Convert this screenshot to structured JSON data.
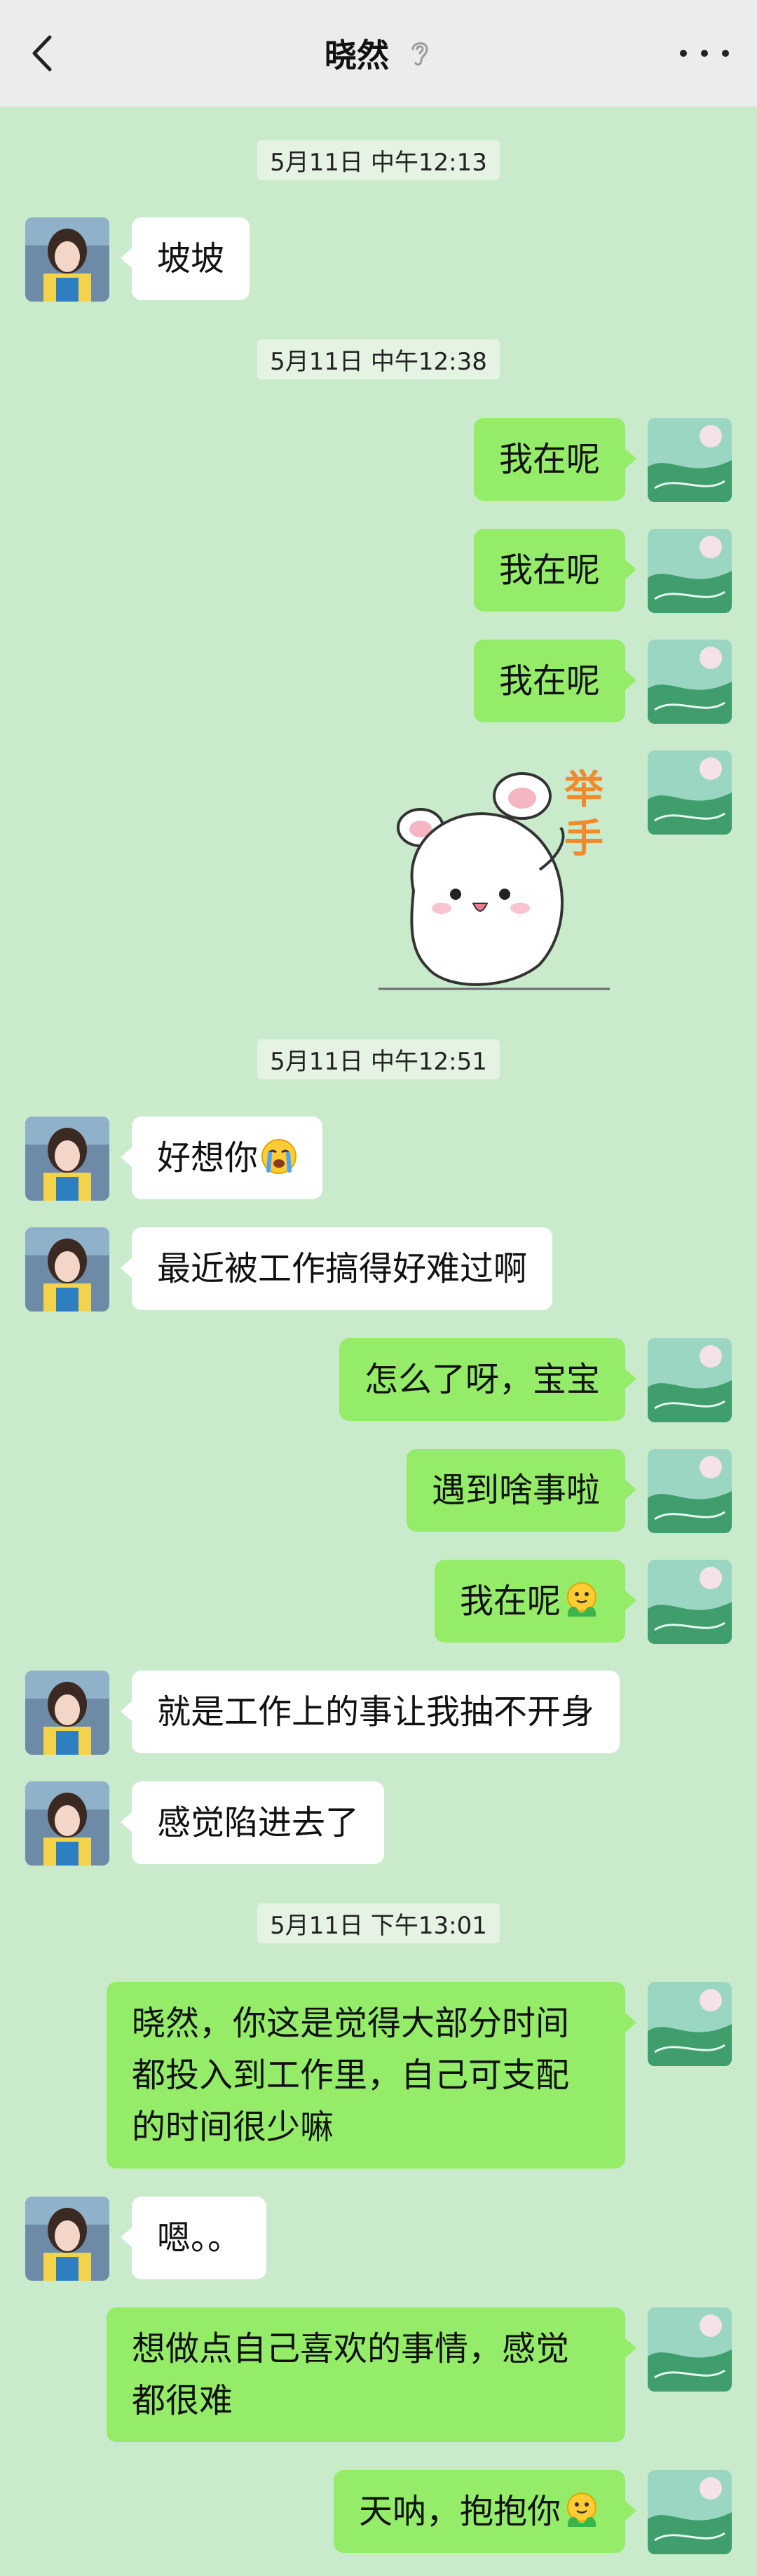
{
  "header": {
    "title": "晓然",
    "back_icon": "chevron-left-icon",
    "ear_icon": "ear-icon",
    "more_icon": "more-dots-icon"
  },
  "timestamps": [
    "5月11日 中午12:13",
    "5月11日 中午12:38",
    "5月11日 中午12:51",
    "5月11日 下午13:01"
  ],
  "messages": [
    {
      "side": "left",
      "text": "坡坡"
    },
    {
      "side": "right",
      "text": "我在呢"
    },
    {
      "side": "right",
      "text": "我在呢"
    },
    {
      "side": "right",
      "text": "我在呢"
    },
    {
      "side": "right",
      "sticker_text": "举手"
    },
    {
      "side": "left",
      "text": "好想你",
      "emoji": "crying-face"
    },
    {
      "side": "left",
      "text": "最近被工作搞得好难过啊"
    },
    {
      "side": "right",
      "text": "怎么了呀，宝宝"
    },
    {
      "side": "right",
      "text": "遇到啥事啦"
    },
    {
      "side": "right",
      "text": "我在呢",
      "emoji": "hug-face"
    },
    {
      "side": "left",
      "text": "就是工作上的事让我抽不开身"
    },
    {
      "side": "left",
      "text": "感觉陷进去了"
    },
    {
      "side": "right",
      "text": "晓然，你这是觉得大部分时间都投入到工作里，自己可支配的时间很少嘛"
    },
    {
      "side": "left",
      "text": "嗯。。"
    },
    {
      "side": "right",
      "text": "想做点自己喜欢的事情，感觉都很难"
    },
    {
      "side": "right",
      "text": "天呐，抱抱你",
      "emoji": "hug-face"
    }
  ],
  "colors": {
    "background": "#c9ebcc",
    "self_bubble": "#95ec69",
    "other_bubble": "#ffffff"
  }
}
